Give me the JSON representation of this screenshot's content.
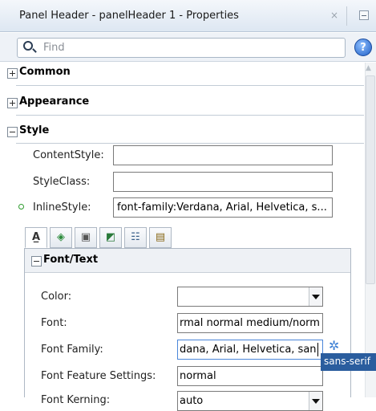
{
  "window": {
    "title": "Panel Header - panelHeader 1 - Properties",
    "close_glyph": "×"
  },
  "search": {
    "placeholder": "Find",
    "help_glyph": "?"
  },
  "sections": {
    "common": "Common",
    "appearance": "Appearance",
    "style": "Style"
  },
  "style": {
    "content_style_label": "ContentStyle:",
    "content_style_value": "",
    "style_class_label": "StyleClass:",
    "style_class_value": "",
    "inline_style_label": "InlineStyle:",
    "inline_style_value": "font-family:Verdana, Arial, Helvetica, s..."
  },
  "style_tabs": [
    {
      "name": "font-text-tab-icon",
      "active": true
    },
    {
      "name": "background-tab-icon",
      "active": false
    },
    {
      "name": "box-tab-icon",
      "active": false
    },
    {
      "name": "layout-tab-icon",
      "active": false
    },
    {
      "name": "table-list-tab-icon",
      "active": false
    },
    {
      "name": "misc-tab-icon",
      "active": false
    }
  ],
  "font_text": {
    "header": "Font/Text",
    "color_label": "Color:",
    "color_value": "",
    "font_label": "Font:",
    "font_value": "rmal normal medium/normal",
    "font_family_label": "Font Family:",
    "font_family_value": "dana, Arial, Helvetica, sans",
    "font_feature_label": "Font Feature Settings:",
    "font_feature_value": "normal",
    "font_kerning_label": "Font Kerning:",
    "font_kerning_value": "auto"
  },
  "tooltip": "sans-serif",
  "colors": {
    "accent": "#1f5fc6",
    "tooltip_bg": "#2a5d9e",
    "active_field_border": "#4a86d9",
    "inline_indicator": "#2e9c2e"
  }
}
